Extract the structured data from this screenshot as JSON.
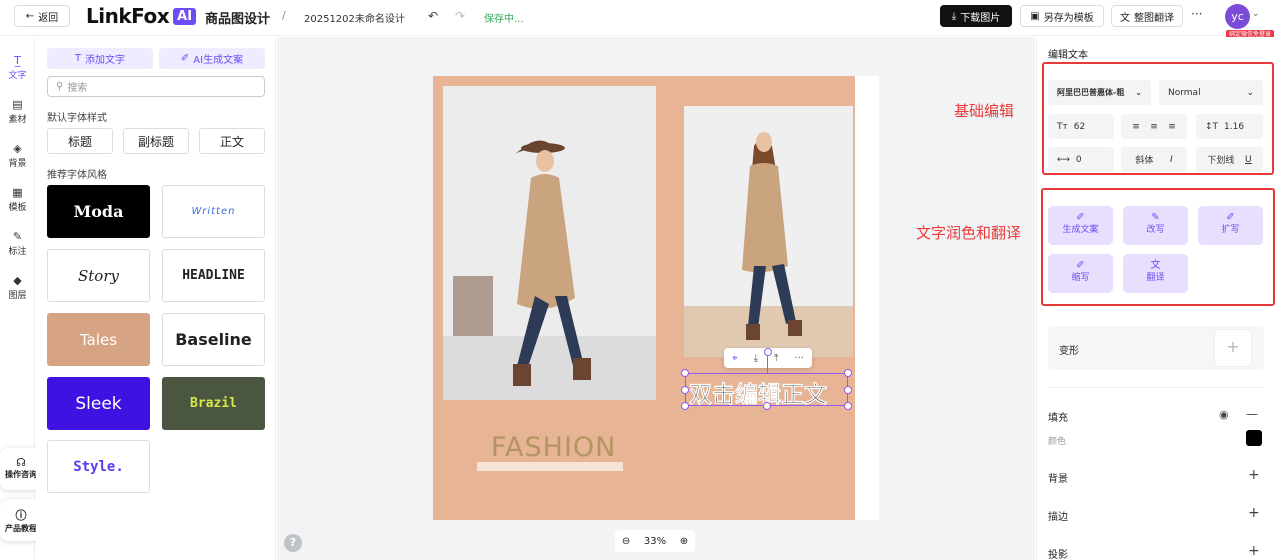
{
  "topbar": {
    "back_label": "返回",
    "logo_text": "LinkFox",
    "logo_ai": "AI",
    "app_title": "商品图设计",
    "separator": "/",
    "doc_name": "20251202未命名设计",
    "saving_status": "保存中...",
    "download_label": "下载图片",
    "save_template_label": "另存为模板",
    "translate_label": "整图翻译",
    "more_label": "···",
    "avatar_initials": "yc",
    "login_badge": "绑定微信免登录"
  },
  "rail": {
    "items": [
      {
        "label": "文字",
        "icon": "text-cursor-icon"
      },
      {
        "label": "素材",
        "icon": "assets-icon"
      },
      {
        "label": "背景",
        "icon": "background-icon"
      },
      {
        "label": "模板",
        "icon": "template-icon"
      },
      {
        "label": "标注",
        "icon": "annotate-icon"
      },
      {
        "label": "图层",
        "icon": "layers-icon"
      }
    ],
    "support_label": "操作咨询",
    "tutorial_label": "产品教程"
  },
  "panel": {
    "add_text_label": "添加文字",
    "ai_copy_label": "AI生成文案",
    "search_placeholder": "搜索",
    "default_styles_heading": "默认字体样式",
    "styles": [
      "标题",
      "副标题",
      "正文"
    ],
    "recommended_heading": "推荐字体风格",
    "font_cards": [
      "Moda",
      "Written",
      "Story",
      "HEADLINE",
      "Tales",
      "Baseline",
      "Sleek",
      "Brazil",
      "Style."
    ]
  },
  "canvas": {
    "fashion_text": "FASHION",
    "selected_text": "双击编辑正文",
    "zoom_level": "33%",
    "help_label": "?",
    "annotation_basic": "基础编辑",
    "annotation_ai": "文字润色和翻译"
  },
  "rpanel": {
    "title": "编辑文本",
    "font_family": "阿里巴巴普惠体-粗",
    "font_weight": "Normal",
    "font_size": "62",
    "line_height": "1.16",
    "letter_spacing": "0",
    "italic_label": "斜体",
    "underline_label": "下划线",
    "ai_actions": [
      "生成文案",
      "改写",
      "扩写",
      "缩写",
      "翻译"
    ],
    "transform_label": "变形",
    "fill_label": "填充",
    "color_label": "颜色",
    "fill_color": "#000000",
    "background_label": "背景",
    "stroke_label": "描边",
    "shadow_label": "投影"
  },
  "colors": {
    "accent": "#6c4cf5",
    "artboard": "#e7b496",
    "annotation": "#e83a3a"
  }
}
